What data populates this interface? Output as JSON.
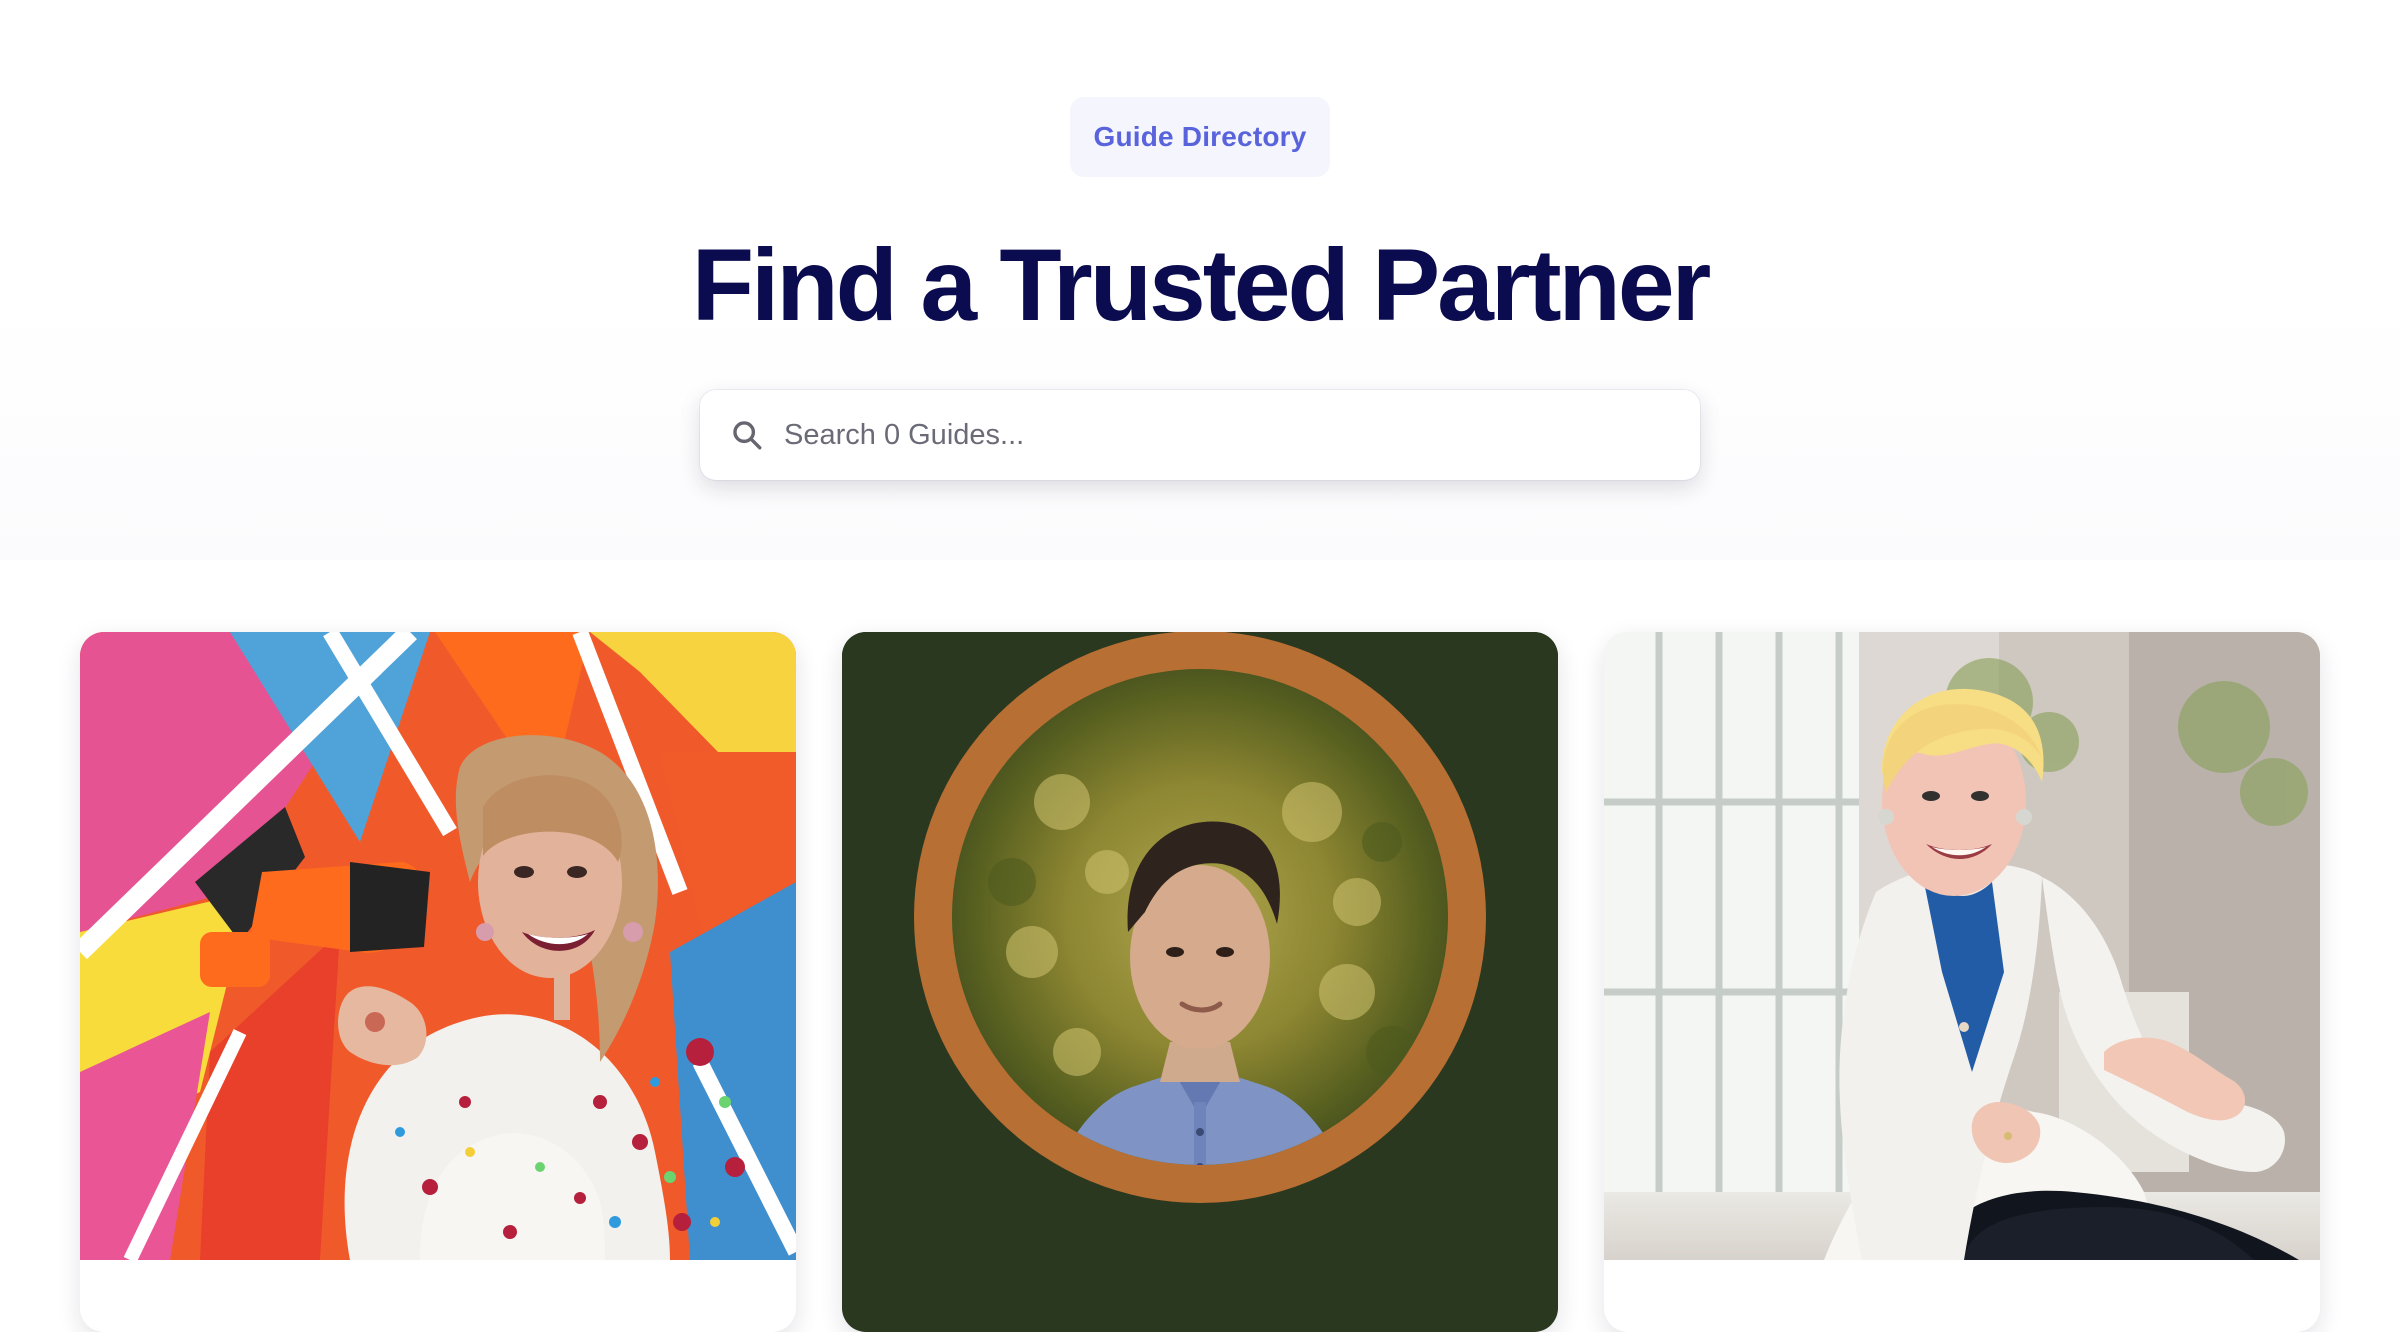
{
  "header": {
    "badge": "Guide Directory",
    "title": "Find a Trusted Partner"
  },
  "search": {
    "placeholder": "Search 0 Guides...",
    "value": ""
  },
  "guides": [
    {
      "photo": "guide-photo-megaphone"
    },
    {
      "photo": "guide-photo-circle-portrait"
    },
    {
      "photo": "guide-photo-white-blazer"
    }
  ],
  "colors": {
    "accent": "#5863dc",
    "badge_bg": "#f4f5fd",
    "heading": "#0b0b4f",
    "card2_bg": "#2a3820",
    "card2_ring": "#b86f33"
  },
  "icons": {
    "search": "search-icon"
  }
}
